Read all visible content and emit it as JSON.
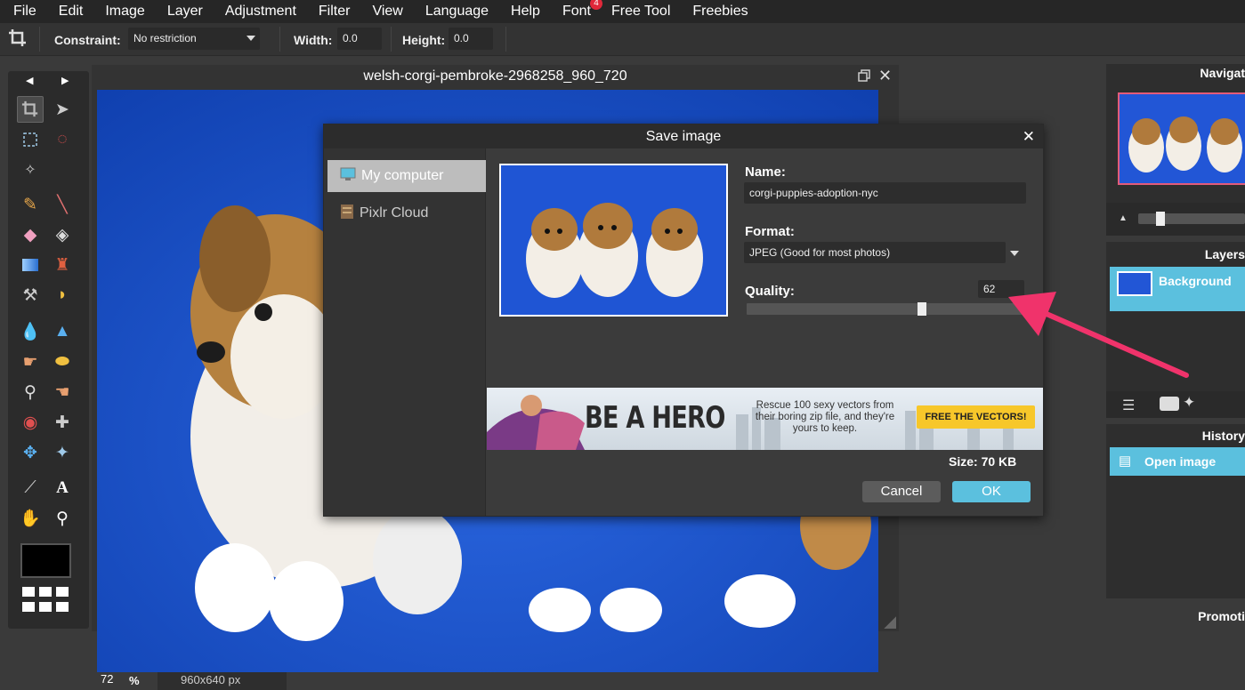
{
  "menubar": {
    "items": [
      "File",
      "Edit",
      "Image",
      "Layer",
      "Adjustment",
      "Filter",
      "View",
      "Language",
      "Help",
      "Font",
      "Free Tool",
      "Freebies"
    ],
    "font_badge": "4"
  },
  "options": {
    "constraint_label": "Constraint:",
    "constraint_value": "No restriction",
    "width_label": "Width:",
    "width_value": "0.0",
    "height_label": "Height:",
    "height_value": "0.0"
  },
  "document": {
    "title": "welsh-corgi-pembroke-2968258_960_720",
    "zoom": "72",
    "zoom_unit": "%",
    "dimensions": "960x640 px"
  },
  "panels": {
    "navigator_title": "Navigat",
    "layers_title": "Layers",
    "layer_name": "Background",
    "history_title": "History",
    "history_item": "Open image",
    "promo_title": "Promoti"
  },
  "dialog": {
    "title": "Save image",
    "sidebar": [
      "My computer",
      "Pixlr Cloud"
    ],
    "name_label": "Name:",
    "name_value": "corgi-puppies-adoption-nyc",
    "format_label": "Format:",
    "format_value": "JPEG (Good for most photos)",
    "quality_label": "Quality:",
    "quality_value": "62",
    "quality_fraction": 0.62,
    "ad": {
      "headline": "BE A HERO",
      "body": "Rescue 100 sexy vectors from their boring zip file, and they're yours to keep.",
      "cta": "FREE THE VECTORS!"
    },
    "size_text": "Size: 70 KB",
    "cancel_label": "Cancel",
    "ok_label": "OK"
  },
  "colors": {
    "accent": "#5bc0de",
    "canvas_bg": "#1a4fc9",
    "arrow": "#f0336b",
    "ad_button": "#f7c72a"
  }
}
